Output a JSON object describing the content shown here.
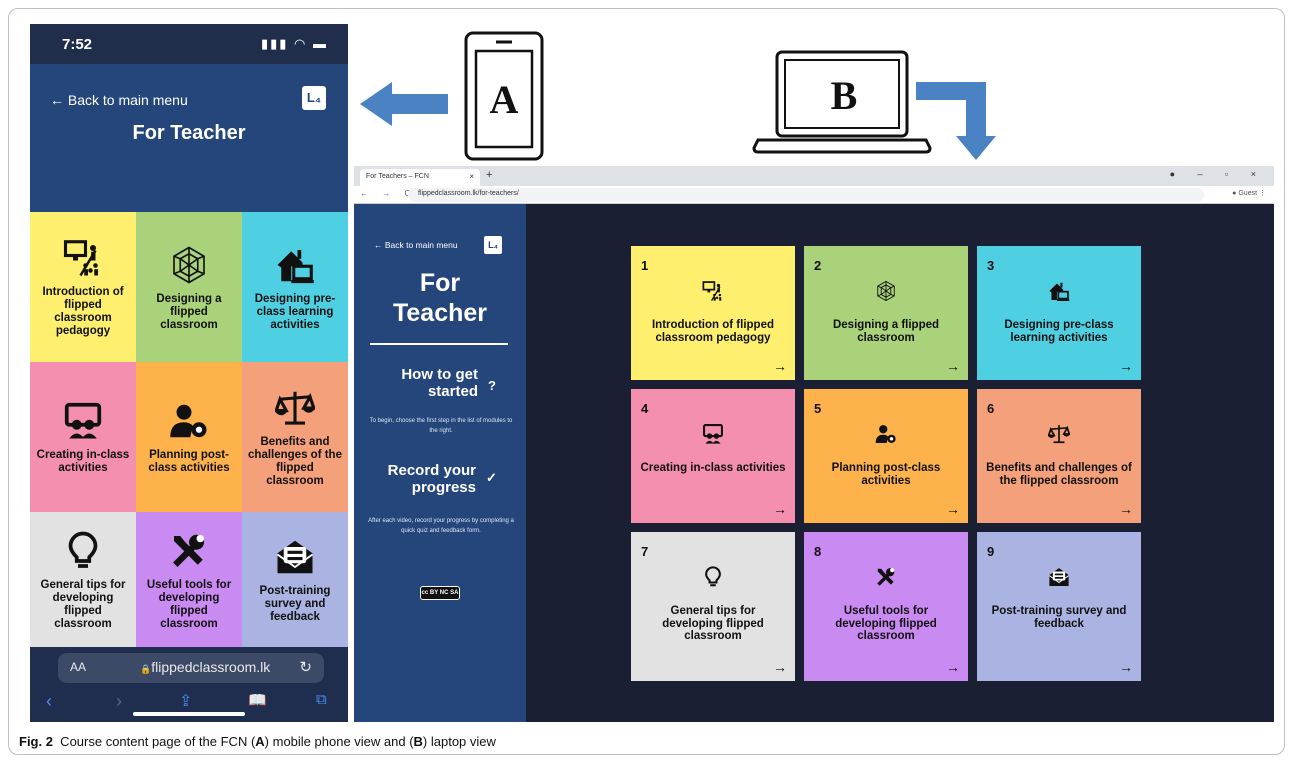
{
  "colors": {
    "yellow": "#fef06e",
    "green": "#a9d27b",
    "cyan": "#4fd0e2",
    "pink": "#f48fb0",
    "orange": "#fdb24b",
    "salmon": "#f4a07a",
    "grey": "#e2e2e2",
    "purple": "#c98af2",
    "lavender": "#aab3e1",
    "navy": "#24467a",
    "dark": "#1a1f33"
  },
  "phone": {
    "time": "7:52",
    "back": "← Back to main menu",
    "logo": "L₄",
    "title": "For Teacher",
    "url": "flippedclassroom.lk",
    "url_lock": "🔒",
    "aa": "AA"
  },
  "devices": {
    "phone_label": "A",
    "laptop_label": "B"
  },
  "browser": {
    "tab_title": "For Teachers – FCN",
    "url": "flippedclassroom.lk/for-teachers/",
    "guest": "Guest"
  },
  "sidebar": {
    "back": "← Back to main menu",
    "logo": "L₄",
    "title_line1": "For",
    "title_line2": "Teacher",
    "heading1": "How to get started",
    "heading1_icon": "?",
    "text1": "To begin, choose the first step in the list of modules to the right.",
    "heading2": "Record your progress",
    "heading2_icon": "✓",
    "text2": "After each video, record your progress by completing a quick quiz and feedback form.",
    "license": "cc BY NC SA"
  },
  "modules": [
    {
      "num": "1",
      "icon": "presentation-icon",
      "phone_label": "Introduction of flipped classroom pedagogy",
      "laptop_label": "Introduction of flipped classroom pedagogy",
      "arrow": "→"
    },
    {
      "num": "2",
      "icon": "geodesic-icon",
      "phone_label": "Designing a flipped classroom",
      "laptop_label": "Designing a flipped classroom",
      "arrow": "→"
    },
    {
      "num": "3",
      "icon": "home-laptop-icon",
      "phone_label": "Designing pre-class learning activities",
      "laptop_label": "Designing pre-class learning activities",
      "arrow": "→"
    },
    {
      "num": "4",
      "icon": "chalkboard-teacher-icon",
      "phone_label": "Creating in-class activities",
      "laptop_label": "Creating in-class activities",
      "arrow": "→"
    },
    {
      "num": "5",
      "icon": "user-cog-icon",
      "phone_label": "Planning post-class activities",
      "laptop_label": "Planning post-class activities",
      "arrow": "→"
    },
    {
      "num": "6",
      "icon": "balance-scale-icon",
      "phone_label": "Benefits and challenges of the flipped classroom",
      "laptop_label": "Benefits and challenges of the flipped classroom",
      "arrow": "→"
    },
    {
      "num": "7",
      "icon": "lightbulb-icon",
      "phone_label": "General tips for developing flipped classroom",
      "laptop_label": "General tips for developing flipped classroom",
      "arrow": "→"
    },
    {
      "num": "8",
      "icon": "tools-icon",
      "phone_label": "Useful tools for developing flipped classroom",
      "laptop_label": "Useful tools for developing flipped classroom",
      "arrow": "→"
    },
    {
      "num": "9",
      "icon": "envelope-survey-icon",
      "phone_label": "Post-training survey and feedback",
      "laptop_label": "Post-training survey and feedback",
      "arrow": "→"
    }
  ],
  "caption": {
    "fig": "Fig. 2",
    "text_before_a": "  Course content page of the FCN (",
    "a": "A",
    "text_mid": ") mobile phone view and (",
    "b": "B",
    "text_end": ") laptop view"
  }
}
